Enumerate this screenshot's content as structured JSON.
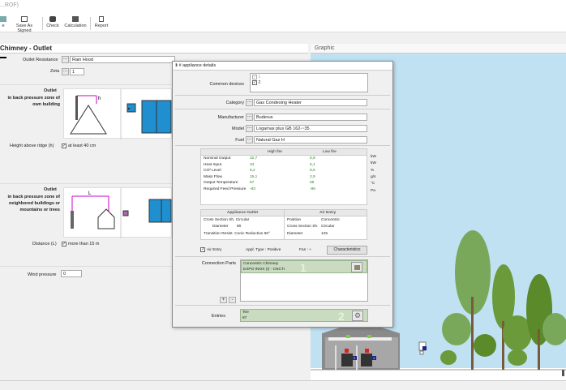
{
  "window": {
    "title": "...ROF)"
  },
  "toolbar": [
    {
      "label": "e"
    },
    {
      "label": "Save As Signed"
    },
    {
      "label": "Check"
    },
    {
      "label": "Calculation"
    },
    {
      "label": "Report"
    }
  ],
  "left": {
    "title": "Chimney - Outlet",
    "outlet_resistance_label": "Outlet Resistance",
    "outlet_resistance_value": "Rain Hood",
    "zeta_label": "Zeta",
    "zeta_value": "1",
    "outlet1_title": "Outlet",
    "outlet1_desc": "in back pressure zone of own building",
    "outlet1_dim": "h",
    "height_label": "Height above ridge (h)",
    "height_value": "at least 40 cm",
    "outlet2_title": "Outlet",
    "outlet2_desc": "in back pressure zone of neighbored buildings or mountains or trees",
    "outlet2_dim": "L",
    "distance_label": "Distance (L)",
    "distance_value": "more than 15 m",
    "wind_label": "Wind pressure",
    "wind_value": "0"
  },
  "graphic": {
    "title": "Graphic",
    "badge1": "1",
    "badge2": "2",
    "badge3": "1"
  },
  "dialog": {
    "title": "1 # appliance details",
    "close": "×",
    "common_devices_label": "Common devices",
    "common_devices": [
      "1",
      "2"
    ],
    "category_label": "Category",
    "category_value": "Gas Condesing Heater",
    "manufacturer_label": "Manufacturer",
    "manufacturer_value": "Buderus",
    "model_label": "Model",
    "model_value": "Logamax plus GB 162-~35",
    "fuel_label": "Fuel",
    "fuel_value": "Natural Gaz H",
    "perf_headers": [
      "High fire",
      "Low fire"
    ],
    "perf_rows": [
      {
        "label": "Nominal Output",
        "high": "32,7",
        "low": "5,8",
        "unit": "kW"
      },
      {
        "label": "Heat Input",
        "high": "34",
        "low": "6,1",
        "unit": "kW"
      },
      {
        "label": "CO² Level",
        "high": "9,2",
        "low": "8,6",
        "unit": "%"
      },
      {
        "label": "Mass Flow",
        "high": "15,1",
        "low": "2,9",
        "unit": "g/s"
      },
      {
        "label": "Output Temperature",
        "high": "67",
        "low": "58",
        "unit": "°C"
      },
      {
        "label": "Required Feed Pressure",
        "high": "-93",
        "low": "-95",
        "unit": "Pa"
      }
    ],
    "appliance_outlet_title": "Appliance Outlet",
    "ao_cross_label": "Cross Section Sh. Circular",
    "ao_diameter_label": "Diameter",
    "ao_diameter_value": "80",
    "ao_transition": "Transition Resist. Conic Reduction 60°",
    "air_entry_title": "Air Entry",
    "ae_position_label": "Position",
    "ae_position_value": "Concentric",
    "ae_cross_label": "Cross Section Sh.",
    "ae_cross_value": "Circular",
    "ae_diameter_label": "Diameter",
    "ae_diameter_value": "125",
    "air_entry_chk": "Air Entry",
    "appl_type": "Appl. Type : Positive",
    "fan": "Fan : +",
    "characteristics_btn": "Characteristics",
    "conn_parts_label": "Connection Parts",
    "conn_parts_text1": "Concentric Chimney",
    "conn_parts_text2": "EXPO INOX (I) - CNCTI",
    "conn_num": "1",
    "plus": "+",
    "minus": "-",
    "entries_label": "Entries",
    "entries_text1": "Tee",
    "entries_text2": "87",
    "entries_num": "2"
  },
  "colors": {
    "accent": "#1f8fd0",
    "green_value": "#2a8a2a",
    "sky": "#bfe1f1",
    "tree": "#5a9a3a"
  }
}
